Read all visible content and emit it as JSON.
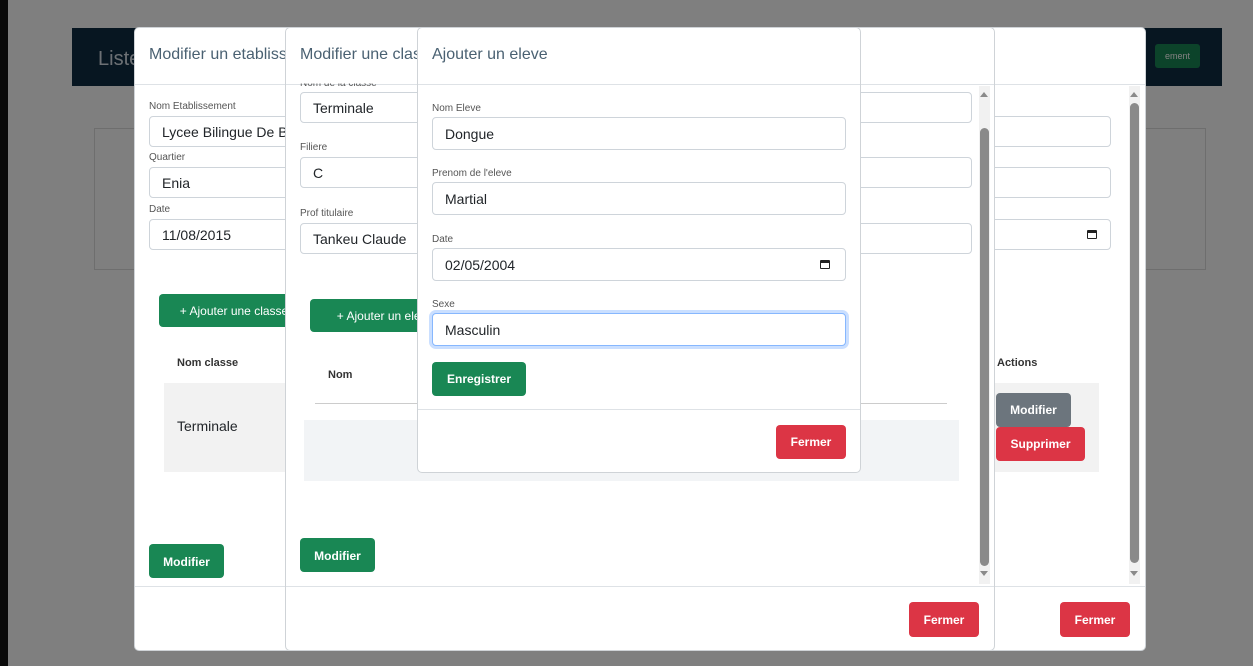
{
  "background": {
    "header_title": "Liste",
    "header_button": "ement"
  },
  "modal_etablissement": {
    "title": "Modifier un etablissement",
    "nom_label": "Nom Etablissement",
    "nom_value": "Lycee Bilingue De Bafang",
    "quartier_label": "Quartier",
    "quartier_value": "Enia",
    "date_label": "Date",
    "date_value": "11/08/2015",
    "add_class_button": "+ Ajouter une classe",
    "table_headers": {
      "nom_classe": "Nom classe",
      "actions": "Actions"
    },
    "row": {
      "nom_classe": "Terminale",
      "modify": "Modifier",
      "delete": "Supprimer"
    },
    "submit_button": "Modifier",
    "close_button": "Fermer"
  },
  "modal_classe": {
    "title": "Modifier une classe",
    "nom_label": "Nom de la classe",
    "nom_value": "Terminale",
    "filiere_label": "Filiere",
    "filiere_value": "C",
    "prof_label": "Prof titulaire",
    "prof_value": "Tankeu Claude",
    "add_student_button": "+ Ajouter un eleve",
    "table_headers": {
      "nom": "Nom"
    },
    "submit_button": "Modifier",
    "close_button": "Fermer"
  },
  "modal_eleve": {
    "title": "Ajouter un eleve",
    "nom_label": "Nom Eleve",
    "nom_value": "Dongue",
    "prenom_label": "Prenom de l'eleve",
    "prenom_value": "Martial",
    "date_label": "Date",
    "date_value": "02/05/2004",
    "sexe_label": "Sexe",
    "sexe_value": "Masculin",
    "save_button": "Enregistrer",
    "close_button": "Fermer"
  },
  "icons": {
    "calendar": "calendar-icon",
    "scroll_up": "scroll-up-arrow-icon",
    "scroll_down": "scroll-down-arrow-icon"
  },
  "colors": {
    "primary_green": "#198754",
    "danger_red": "#dc3545",
    "secondary_gray": "#6c757d",
    "header_navy": "#0f2d43"
  }
}
